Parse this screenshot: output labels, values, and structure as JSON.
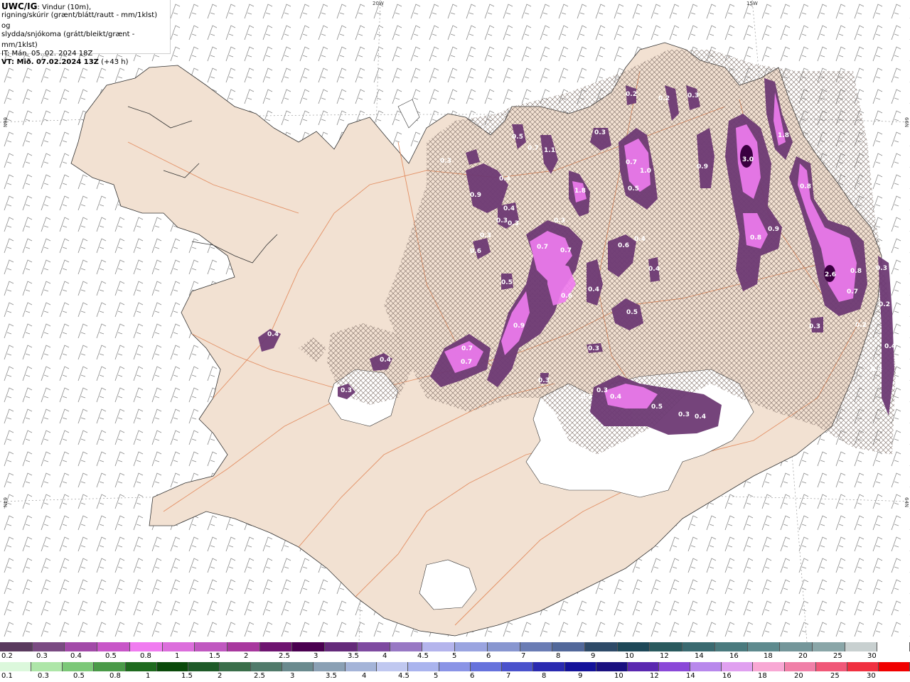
{
  "header": {
    "model": "UWC/IG",
    "line1": ": Vindur (10m),",
    "line2": "rigning/skúrir (grænt/blátt/rautt - mm/1klst) og",
    "line3": "slydda/snjókoma (grátt/bleikt/grænt - mm/1klst)",
    "it_line": "IT: Mán. 05. 02. 2024 18Z",
    "vt_label": "VT: Mið. 07.02.2024 13Z",
    "vt_offset": " (+43 h)"
  },
  "graticule": {
    "lon_20w": "20W",
    "lon_15w": "15W",
    "lat_66n_left": "66N",
    "lat_66n_right": "66N",
    "lat_64n_left": "64N",
    "lat_64n_right": "64N"
  },
  "cells": [
    {
      "label": "3.0",
      "color": "#3a0040"
    },
    {
      "label": "2.6",
      "color": "#3a0040"
    },
    {
      "label": "1.8"
    },
    {
      "label": "1.8"
    },
    {
      "label": "1.0"
    },
    {
      "label": "1.1"
    },
    {
      "label": "0.9"
    },
    {
      "label": "0.9"
    },
    {
      "label": "0.9"
    },
    {
      "label": "0.9"
    },
    {
      "label": "0.8"
    },
    {
      "label": "0.8"
    },
    {
      "label": "0.8"
    },
    {
      "label": "0.7"
    },
    {
      "label": "0.7"
    },
    {
      "label": "0.7"
    },
    {
      "label": "0.7"
    },
    {
      "label": "0.7"
    },
    {
      "label": "0.7"
    },
    {
      "label": "0.7"
    },
    {
      "label": "0.6"
    },
    {
      "label": "0.6"
    },
    {
      "label": "0.6"
    },
    {
      "label": "0.5"
    },
    {
      "label": "0.5"
    },
    {
      "label": "0.5"
    },
    {
      "label": "0.5"
    },
    {
      "label": "0.5"
    },
    {
      "label": "0.4"
    },
    {
      "label": "0.4"
    },
    {
      "label": "0.4"
    },
    {
      "label": "0.4"
    },
    {
      "label": "0.4"
    },
    {
      "label": "0.4"
    },
    {
      "label": "0.4"
    },
    {
      "label": "0.4"
    },
    {
      "label": "0.4"
    },
    {
      "label": "0.4"
    },
    {
      "label": "0.3"
    },
    {
      "label": "0.3"
    },
    {
      "label": "0.3"
    },
    {
      "label": "0.3"
    },
    {
      "label": "0.3"
    },
    {
      "label": "0.3"
    },
    {
      "label": "0.3"
    },
    {
      "label": "0.3"
    },
    {
      "label": "0.3"
    },
    {
      "label": "0.3"
    },
    {
      "label": "0.3"
    },
    {
      "label": "0.3"
    },
    {
      "label": "0.3"
    },
    {
      "label": "0.3"
    },
    {
      "label": "0.3"
    },
    {
      "label": "0.3"
    },
    {
      "label": "0.2"
    },
    {
      "label": "0.2"
    },
    {
      "label": "0.2"
    },
    {
      "label": "0.2"
    }
  ],
  "legend_snow": {
    "colors": [
      "#5a3a5e",
      "#7a4a82",
      "#a24aa8",
      "#c856c8",
      "#f07cf0",
      "#dc6edc",
      "#c058c0",
      "#a8389e",
      "#6e1470",
      "#4a0050",
      "#642a7a",
      "#7e4aa0",
      "#9878c4",
      "#b4b4ec",
      "#9aa4e0",
      "#8896d0",
      "#6a7cb4",
      "#52689a",
      "#2e4a68",
      "#1e4858",
      "#2a5a5e",
      "#3a6a70",
      "#4a7a7e",
      "#5e8a8e",
      "#74969a",
      "#8aa6a8",
      "#c8d0d0",
      "#ffffff"
    ],
    "labels": [
      "0.2",
      "0.3",
      "0.4",
      "0.5",
      "0.8",
      "1",
      "1.5",
      "2",
      "2.5",
      "3",
      "3.5",
      "4",
      "4.5",
      "5",
      "6",
      "7",
      "8",
      "9",
      "10",
      "12",
      "14",
      "16",
      "18",
      "20",
      "25",
      "30"
    ]
  },
  "legend_rain": {
    "colors": [
      "#dcf8dc",
      "#aee6a8",
      "#7cc878",
      "#4a9a48",
      "#1e6a1e",
      "#0a4a0a",
      "#1e5a28",
      "#3a6e4a",
      "#507a6a",
      "#6a8a8e",
      "#8aa0b4",
      "#a4b4d8",
      "#c0c8f0",
      "#aab4ee",
      "#8a94e6",
      "#6672dc",
      "#4a52cc",
      "#2a2ab0",
      "#14129a",
      "#1a1080",
      "#5a28b0",
      "#8a48d8",
      "#b888ec",
      "#e0a0f0",
      "#f8a8d4",
      "#f080a8",
      "#f05878",
      "#f03040",
      "#f00000"
    ],
    "labels": [
      "0.1",
      "0.3",
      "0.5",
      "0.8",
      "1",
      "1.5",
      "2",
      "2.5",
      "3",
      "3.5",
      "4",
      "4.5",
      "5",
      "6",
      "7",
      "8",
      "9",
      "10",
      "12",
      "14",
      "16",
      "18",
      "20",
      "25",
      "30"
    ]
  }
}
